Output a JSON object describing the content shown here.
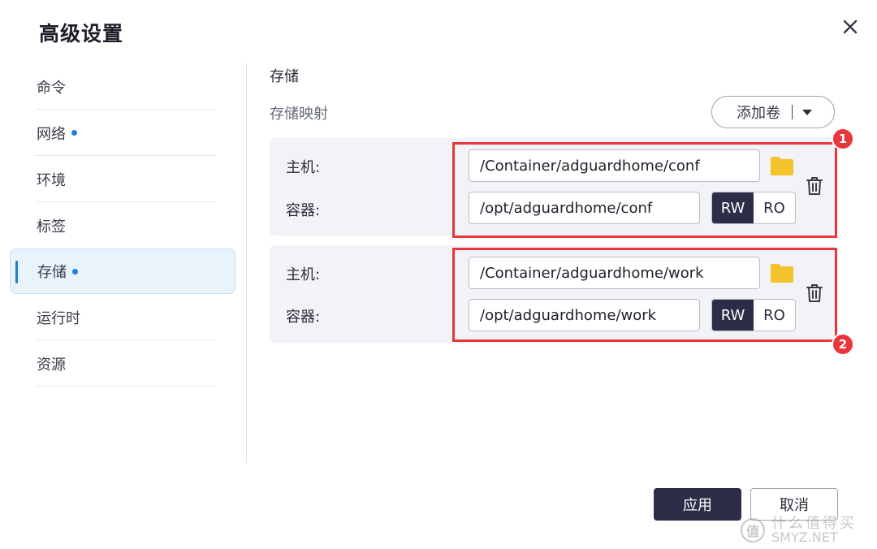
{
  "dialog": {
    "title": "高级设置"
  },
  "sidebar": {
    "items": [
      {
        "label": "命令",
        "dot": false,
        "active": false
      },
      {
        "label": "网络",
        "dot": true,
        "active": false
      },
      {
        "label": "环境",
        "dot": false,
        "active": false
      },
      {
        "label": "标签",
        "dot": false,
        "active": false
      },
      {
        "label": "存储",
        "dot": true,
        "active": true
      },
      {
        "label": "运行时",
        "dot": false,
        "active": false
      },
      {
        "label": "资源",
        "dot": false,
        "active": false
      }
    ]
  },
  "storage": {
    "title": "存储",
    "mapping_label": "存储映射",
    "add_volume_label": "添加卷",
    "host_label": "主机:",
    "container_label": "容器:",
    "mappings": [
      {
        "host_path": "/Container/adguardhome/conf",
        "container_path": "/opt/adguardhome/conf",
        "mode_rw": "RW",
        "mode_ro": "RO",
        "selected_mode": "RW",
        "marker": "1"
      },
      {
        "host_path": "/Container/adguardhome/work",
        "container_path": "/opt/adguardhome/work",
        "mode_rw": "RW",
        "mode_ro": "RO",
        "selected_mode": "RW",
        "marker": "2"
      }
    ]
  },
  "footer": {
    "apply_label": "应用",
    "cancel_label": "取消"
  },
  "watermark": {
    "icon_text": "值",
    "text_cn": "什么值得买",
    "text_en": "SMYZ.NET"
  },
  "colors": {
    "accent": "#1f7fd8",
    "primary_button": "#2d2d48",
    "highlight": "#e8363a",
    "folder": "#f4c22b"
  },
  "icons": {
    "close": "close-icon",
    "folder": "folder-icon",
    "delete": "trash-icon",
    "dropdown": "caret-down-icon"
  }
}
